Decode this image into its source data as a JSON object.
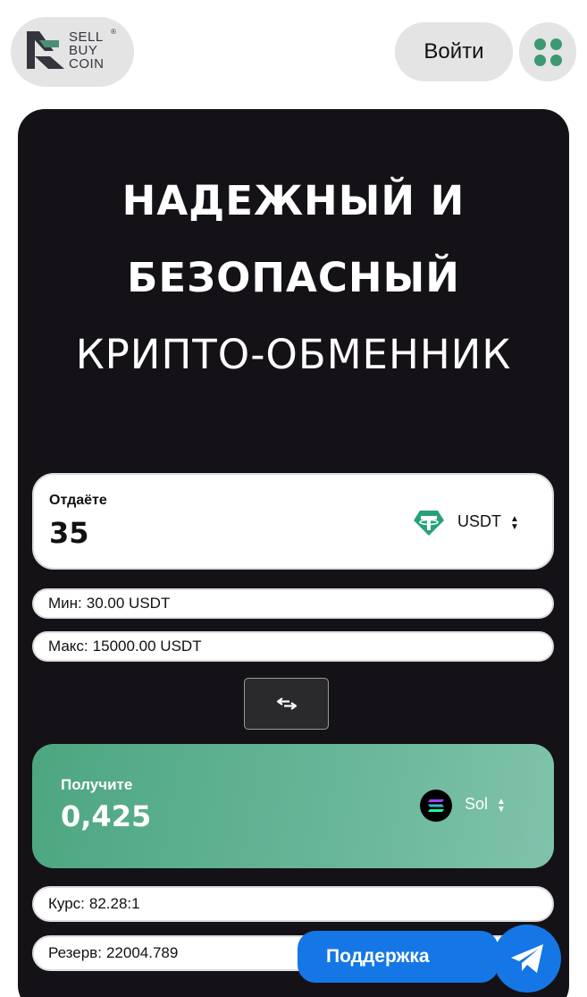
{
  "header": {
    "logo_lines": [
      "SELL",
      "BUY",
      "COIN"
    ],
    "logo_registered": "®",
    "login_label": "Войти",
    "menu_icon": "grid-dots-icon"
  },
  "hero": {
    "title_lines": [
      "НАДЕЖНЫЙ И",
      "БЕЗОПАСНЫЙ",
      "КРИПТО-ОБМЕННИК"
    ]
  },
  "exchange": {
    "give": {
      "label": "Отдаёте",
      "amount": "35",
      "currency": "USDT",
      "currency_icon": "tether-icon"
    },
    "min": {
      "label": "Мин:",
      "value": "30.00 USDT"
    },
    "max": {
      "label": "Макс:",
      "value": "15000.00 USDT"
    },
    "swap_icon": "swap-arrows-icon",
    "receive": {
      "label": "Получите",
      "amount": "0,425",
      "currency": "Sol",
      "currency_icon": "solana-icon"
    },
    "rate": {
      "label": "Курс:",
      "value": "82.28:1"
    },
    "reserve": {
      "label": "Резерв:",
      "value": "22004.789"
    }
  },
  "support": {
    "label": "Поддержка",
    "icon": "telegram-icon"
  },
  "colors": {
    "accent_green": "#3b9a73",
    "hero_bg": "#141216",
    "support_blue": "#1577e6"
  }
}
